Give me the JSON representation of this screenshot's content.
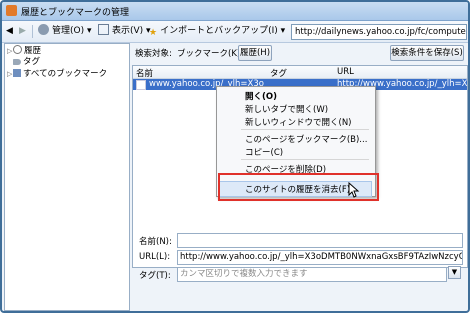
{
  "window": {
    "title": "履歴とブックマークの管理"
  },
  "toolbar": {
    "manage_label": "管理(O)",
    "view_label": "表示(V)",
    "import_backup_label": "インポートとバックアップ(I)",
    "url_value": "http://dailynews.yahoo.co.jp/fc/computer/i"
  },
  "sidebar": {
    "items": [
      {
        "label": "履歴"
      },
      {
        "label": "タグ"
      },
      {
        "label": "すべてのブックマーク"
      }
    ]
  },
  "search": {
    "label": "検索対象:",
    "bookmark_scope": "ブックマーク(K)",
    "history_scope": "履歴(H)",
    "save_button": "検索条件を保存(S)"
  },
  "list": {
    "columns": [
      "名前",
      "タグ",
      "URL"
    ],
    "rows": [
      {
        "name": "www.yahoo.co.jp/_ylh=X3o",
        "tag": "",
        "url": "http://www.yahoo.co.jp/_ylh=X3..."
      }
    ]
  },
  "context_menu": {
    "items": [
      "開く(O)",
      "新しいタブで開く(W)",
      "新しいウィンドウで開く(N)",
      "このページをブックマーク(B)...",
      "コピー(C)",
      "このページを削除(D)",
      "このサイトの履歴を消去(F)"
    ]
  },
  "details": {
    "name_label": "名前(N):",
    "name_value": "",
    "url_label": "URL(L):",
    "url_value": "http://www.yahoo.co.jp/_ylh=X3oDMTB0NWxnaGxsBF9TAzIwNzcyOTYyNjU0",
    "tag_label": "タグ(T):",
    "tag_placeholder": "カンマ区切りで複数入力できます"
  },
  "colors": {
    "accent": "#3a6fc9",
    "highlight_box": "#e0312a",
    "title_bar": "#a9c8ea"
  }
}
